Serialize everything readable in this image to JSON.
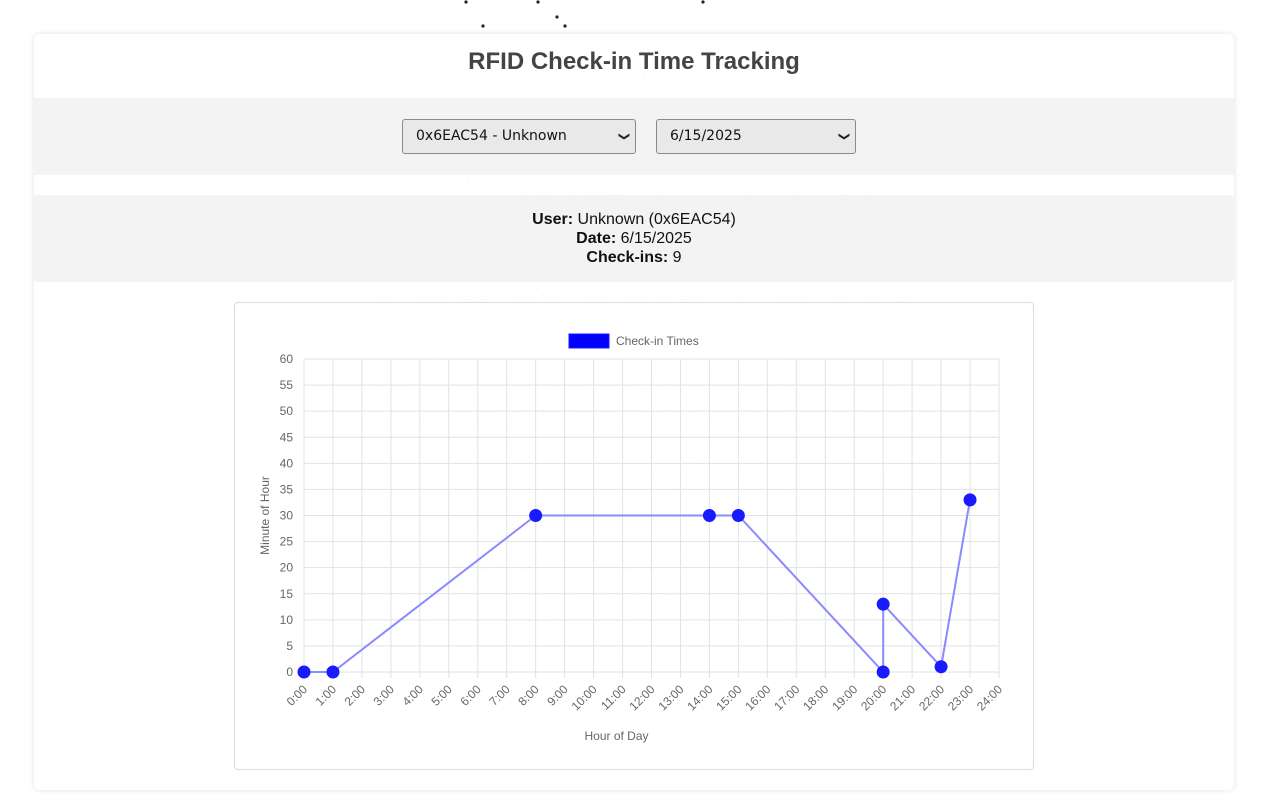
{
  "page": {
    "title": "RFID Check-in Time Tracking"
  },
  "controls": {
    "user_select": {
      "selected": "0x6EAC54 - Unknown"
    },
    "date_select": {
      "selected": "6/15/2025"
    }
  },
  "info": {
    "user_label": "User:",
    "user_value": "Unknown (0x6EAC54)",
    "date_label": "Date:",
    "date_value": "6/15/2025",
    "checkins_label": "Check-ins:",
    "checkins_value": "9"
  },
  "icons": {
    "select_chevron": "chevron-down-icon"
  },
  "colors": {
    "series": "#1a1aff",
    "line": "#8a8aff",
    "legend": "#0000ff"
  },
  "chart_data": {
    "type": "line",
    "title": "",
    "legend": [
      "Check-in Times"
    ],
    "legend_position": "top",
    "xlabel": "Hour of Day",
    "ylabel": "Minute of Hour",
    "xlim": [
      0,
      24
    ],
    "ylim": [
      0,
      60
    ],
    "x_tick_labels": [
      "0:00",
      "1:00",
      "2:00",
      "3:00",
      "4:00",
      "5:00",
      "6:00",
      "7:00",
      "8:00",
      "9:00",
      "10:00",
      "11:00",
      "12:00",
      "13:00",
      "14:00",
      "15:00",
      "16:00",
      "17:00",
      "18:00",
      "19:00",
      "20:00",
      "21:00",
      "22:00",
      "23:00",
      "24:00"
    ],
    "y_ticks": [
      0,
      5,
      10,
      15,
      20,
      25,
      30,
      35,
      40,
      45,
      50,
      55,
      60
    ],
    "grid": true,
    "series": [
      {
        "name": "Check-in Times",
        "points": [
          {
            "x": 0,
            "y": 0
          },
          {
            "x": 1,
            "y": 0
          },
          {
            "x": 8,
            "y": 30
          },
          {
            "x": 14,
            "y": 30
          },
          {
            "x": 15,
            "y": 30
          },
          {
            "x": 20,
            "y": 0
          },
          {
            "x": 20,
            "y": 13
          },
          {
            "x": 22,
            "y": 1
          },
          {
            "x": 23,
            "y": 33
          }
        ]
      }
    ]
  }
}
